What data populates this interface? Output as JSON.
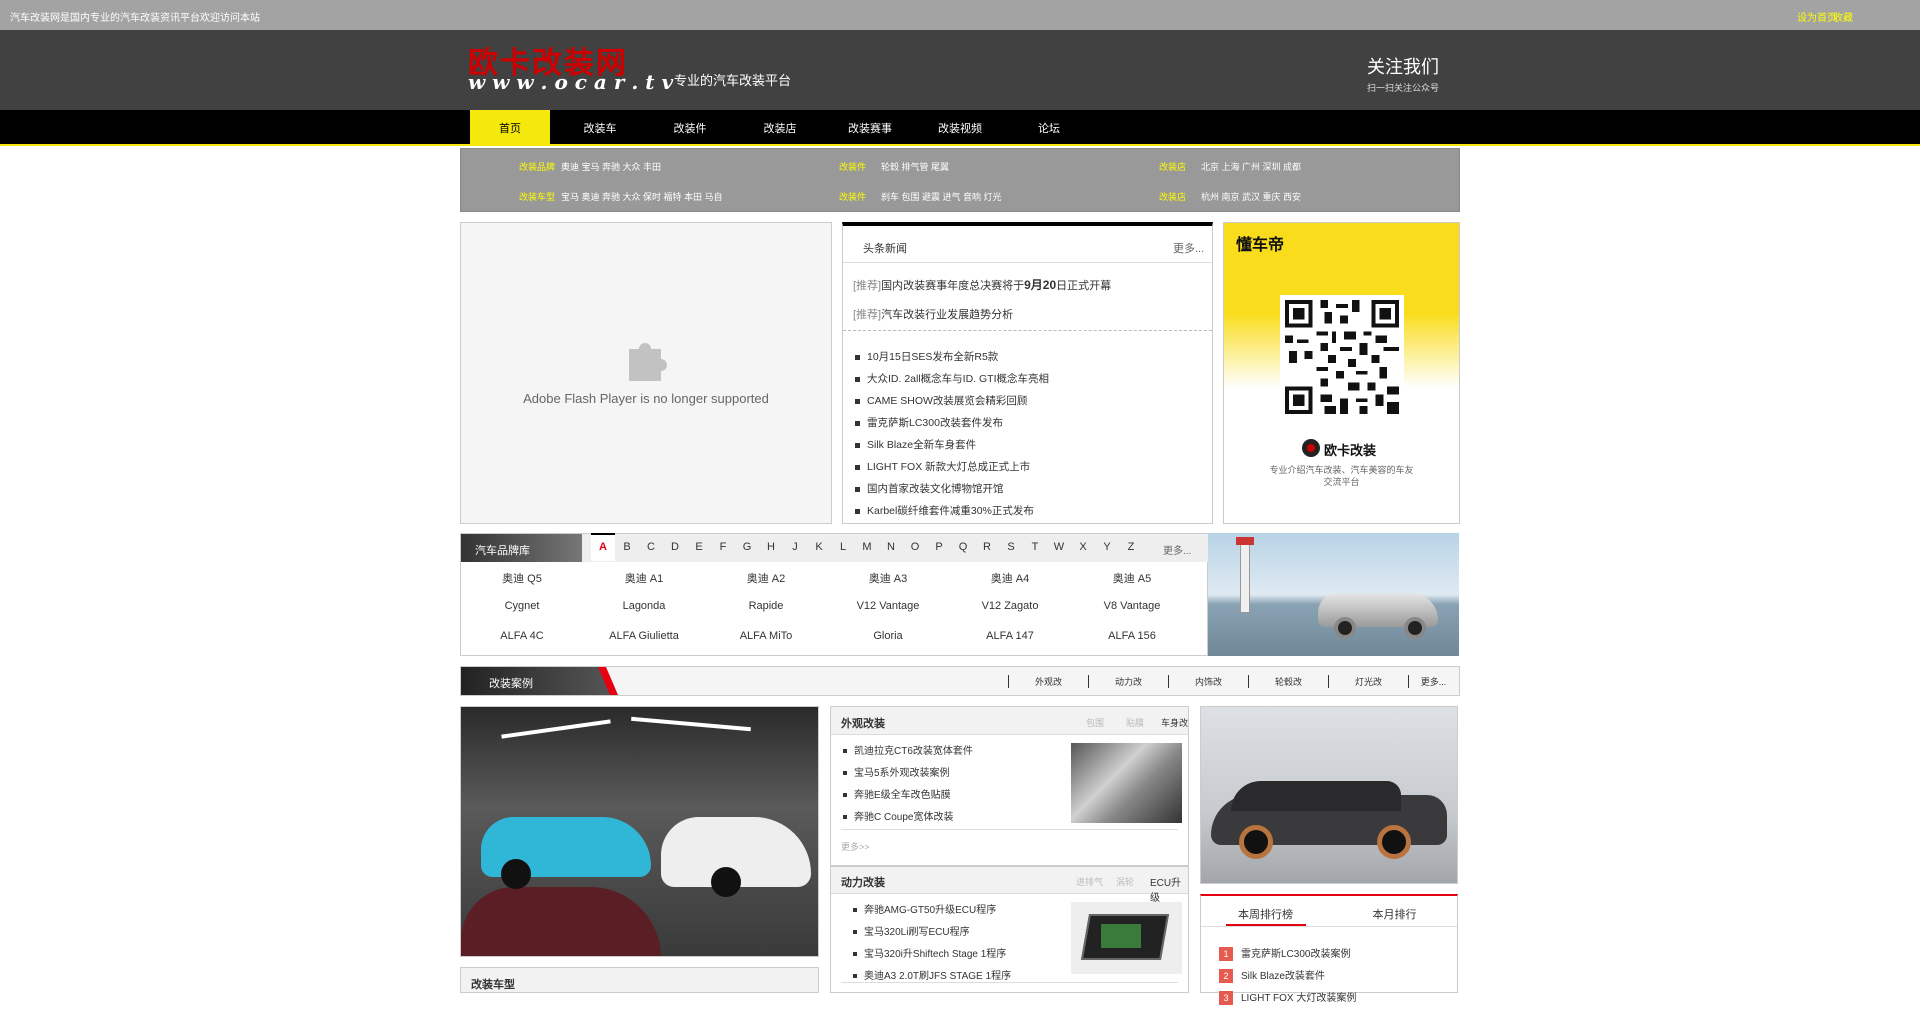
{
  "topbar": {
    "left_text": "汽车改装网是国内专业的汽车改装资讯平台欢迎访问本站",
    "right_links": [
      "设为首页",
      "收藏"
    ]
  },
  "logo": {
    "cn": "欧卡改装网",
    "url": "w w w . o c a r . t v",
    "slogan": "专业的汽车改装平台"
  },
  "header_right": {
    "title": "关注我们",
    "subtitle": "扫一扫关注公众号"
  },
  "nav": [
    "首页",
    "改装车",
    "改装件",
    "改装店",
    "改装赛事",
    "改装视频",
    "论坛"
  ],
  "sub_rows": [
    [
      {
        "label": "改装品牌",
        "items": "奥迪 宝马 奔驰 大众 丰田"
      },
      {
        "label": "改装件",
        "items": "轮毂 排气管 尾翼"
      },
      {
        "label": "改装店",
        "items": "北京 上海 广州 深圳 成都"
      }
    ],
    [
      {
        "label": "改装车型",
        "items": "宝马 奥迪 奔驰 大众 保时 福特 本田 马自"
      },
      {
        "label": "改装件",
        "items": "刹车 包围 避震 进气 音响 灯光"
      },
      {
        "label": "改装店",
        "items": "杭州 南京 武汉 重庆 西安"
      }
    ]
  ],
  "flash": {
    "message": "Adobe Flash Player is no longer supported"
  },
  "headline": {
    "tab": "头条新闻",
    "more": "更多...",
    "top": [
      {
        "prefix": "[推荐]",
        "text": "国内改装赛事年度总决赛将于",
        "bold": "9月20",
        "rest": "日正式开幕"
      },
      {
        "prefix": "[推荐]",
        "text": "汽车改装行业发展趋势分析"
      }
    ],
    "list": [
      "10月15日SES发布全新R5款",
      "大众ID. 2all概念车与ID. GTI概念车亮相",
      "CAME SHOW改装展览会精彩回顾",
      "雷克萨斯LC300改装套件发布",
      "Silk Blaze全新车身套件",
      "LIGHT FOX 新款大灯总成正式上市",
      "国内首家改装文化博物馆开馆",
      "Karbel碳纤维套件减重30%正式发布"
    ]
  },
  "qr_ad": {
    "brand": "懂车帝",
    "name": "欧卡改装",
    "desc1": "专业介绍汽车改装、汽车美容的车友",
    "desc2": "交流平台"
  },
  "brands": {
    "title": "汽车品牌库",
    "letters": [
      "A",
      "B",
      "C",
      "D",
      "E",
      "F",
      "G",
      "H",
      "J",
      "K",
      "L",
      "M",
      "N",
      "O",
      "P",
      "Q",
      "R",
      "S",
      "T",
      "W",
      "X",
      "Y",
      "Z"
    ],
    "active": "A",
    "more": "更多...",
    "rows": [
      [
        "奥迪 Q5",
        "奥迪 A1",
        "奥迪 A2",
        "奥迪 A3",
        "奥迪 A4",
        "奥迪 A5"
      ],
      [
        "Cygnet",
        "Lagonda",
        "Rapide",
        "V12 Vantage",
        "V12 Zagato",
        "V8 Vantage"
      ],
      [
        "ALFA 4C",
        "ALFA Giulietta",
        "ALFA MiTo",
        "Gloria",
        "ALFA 147",
        "ALFA 156"
      ]
    ]
  },
  "section": {
    "title": "改装案例",
    "tabs": [
      "外观改",
      "动力改",
      "内饰改",
      "轮毂改",
      "灯光改"
    ],
    "more": "更多..."
  },
  "box1": {
    "title": "外观改装",
    "tabs": [
      "包围",
      "贴膜",
      "车身改"
    ],
    "items": [
      "凯迪拉克CT6改装宽体套件",
      "宝马5系外观改装案例",
      "奔驰E级全车改色贴膜",
      "奔驰C Coupe宽体改装"
    ],
    "footer": "更多>>"
  },
  "box2": {
    "title": "动力改装",
    "tabs": [
      "进排气",
      "涡轮",
      "ECU升级"
    ],
    "items": [
      "奔驰AMG-GT50升级ECU程序",
      "宝马320Li刷写ECU程序",
      "宝马320i升Shiftech Stage 1程序",
      "奥迪A3 2.0T刷JFS STAGE 1程序"
    ]
  },
  "rank": {
    "tabs": [
      "本周排行榜",
      "本月排行"
    ],
    "items": [
      "雷克萨斯LC300改装案例",
      "Silk Blaze改装套件",
      "LIGHT FOX 大灯改装案例"
    ]
  },
  "box3": {
    "title": "改装车型"
  },
  "colors": {
    "accent": "#f4e90a",
    "red": "#e60012",
    "nav_bg": "#000000"
  }
}
